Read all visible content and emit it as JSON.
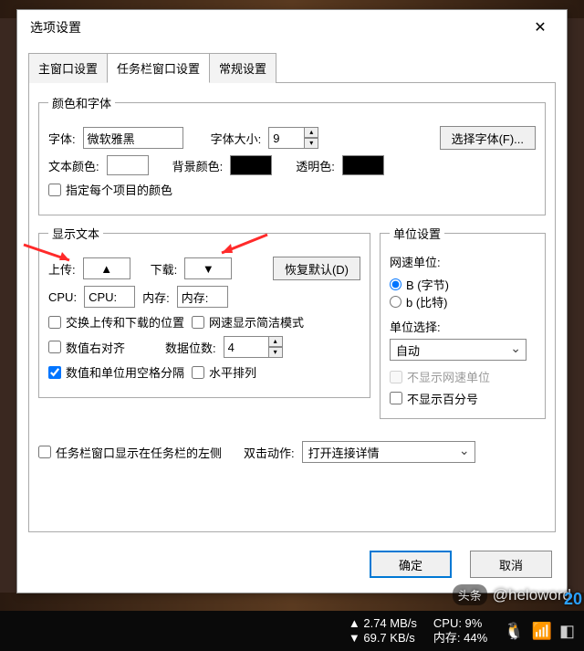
{
  "dialog": {
    "title": "选项设置"
  },
  "tabs": {
    "t0": "主窗口设置",
    "t1": "任务栏窗口设置",
    "t2": "常规设置",
    "active": 1
  },
  "fs_color": {
    "legend": "颜色和字体",
    "font_label": "字体:",
    "font_value": "微软雅黑",
    "size_label": "字体大小:",
    "size_value": "9",
    "choose_font_btn": "选择字体(F)...",
    "text_color_label": "文本颜色:",
    "bg_color_label": "背景颜色:",
    "trans_color_label": "透明色:",
    "per_item_color": "指定每个项目的颜色"
  },
  "fs_text": {
    "legend": "显示文本",
    "upload_label": "上传:",
    "upload_value": "▲",
    "download_label": "下载:",
    "download_value": "▼",
    "restore_btn": "恢复默认(D)",
    "cpu_label": "CPU:",
    "cpu_value": "CPU:",
    "mem_label": "内存:",
    "mem_value": "内存:",
    "chk_swap": "交换上传和下载的位置",
    "chk_compact": "网速显示简洁模式",
    "chk_right_align": "数值右对齐",
    "digits_label": "数据位数:",
    "digits_value": "4",
    "chk_space_sep": "数值和单位用空格分隔",
    "chk_horizontal": "水平排列"
  },
  "fs_unit": {
    "legend": "单位设置",
    "net_unit_label": "网速单位:",
    "opt_byte": "B (字节)",
    "opt_bit": "b (比特)",
    "unit_select_label": "单位选择:",
    "unit_select_value": "自动",
    "chk_hide_net_unit": "不显示网速单位",
    "chk_hide_percent": "不显示百分号"
  },
  "bottom": {
    "show_left": "任务栏窗口显示在任务栏的左侧",
    "dbl_label": "双击动作:",
    "dbl_value": "打开连接详情"
  },
  "actions": {
    "ok": "确定",
    "cancel": "取消"
  },
  "taskbar": {
    "up": "▲ 2.74 MB/s",
    "down": "▼ 69.7 KB/s",
    "cpu": "CPU: 9%",
    "mem": "内存: 44%"
  },
  "watermark": {
    "prefix": "头条",
    "handle": "@heloword"
  },
  "colors": {
    "text_color": "#ffffff",
    "bg_color": "#000000",
    "trans_color": "#000000"
  }
}
